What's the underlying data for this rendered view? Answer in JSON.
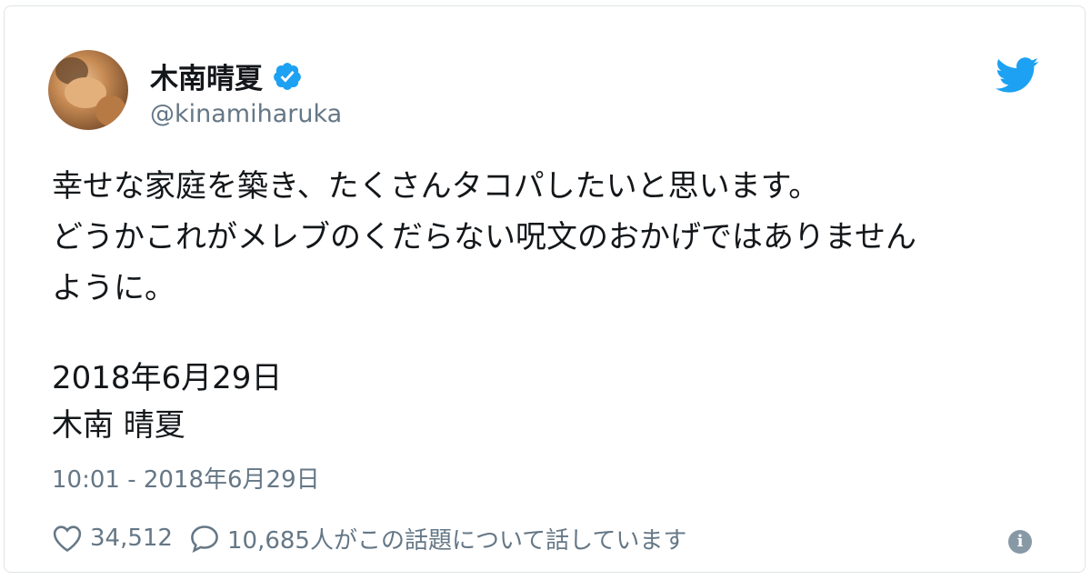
{
  "author": {
    "display_name": "木南晴夏",
    "handle": "@kinamiharuka",
    "verified_icon": "verified-badge-icon",
    "avatar_icon": "avatar"
  },
  "brand": {
    "icon": "twitter-bird-icon",
    "color": "#1da1f2"
  },
  "tweet": {
    "lines": [
      "幸せな家庭を築き、たくさんタコパしたいと思います。",
      "どうかこれがメレブのくだらない呪文のおかげではありません",
      "ように。"
    ],
    "signature": [
      "2018年6月29日",
      "木南 晴夏"
    ],
    "timestamp": "10:01 - 2018年6月29日"
  },
  "actions": {
    "likes": "34,512",
    "replies_text": "10,685人がこの話題について話しています",
    "like_icon": "heart-icon",
    "reply_icon": "speech-bubble-icon",
    "info_icon": "info-icon",
    "info_glyph": "i"
  },
  "colors": {
    "text": "#14171a",
    "secondary": "#657786",
    "verified": "#1da1f2",
    "border": "#dfe3e6"
  }
}
